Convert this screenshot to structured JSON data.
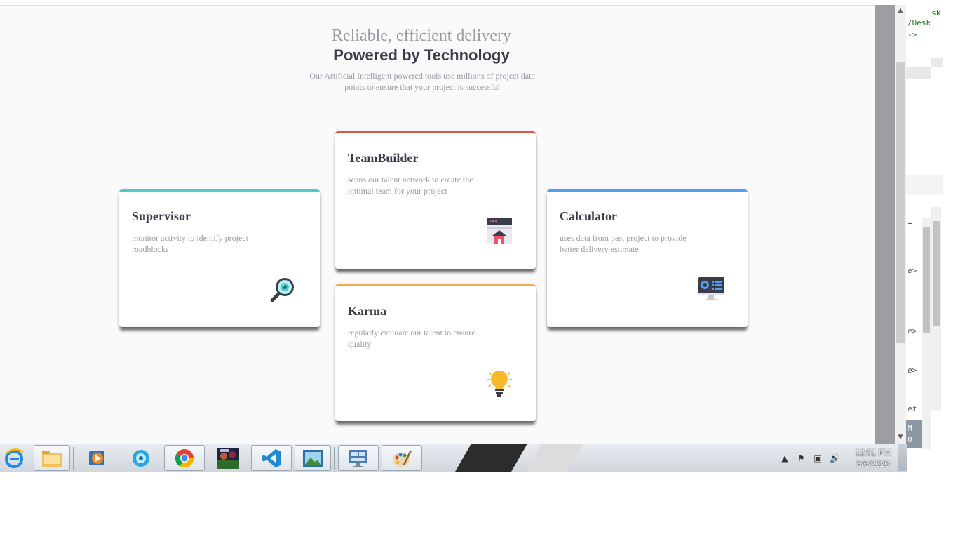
{
  "header": {
    "subtitle": "Reliable, efficient delivery",
    "title": "Powered by Technology",
    "description": "Our Artificial Intelligent powered tools use millions of project data points to ensure that your project is successful"
  },
  "cards": {
    "supervisor": {
      "title": "Supervisor",
      "text": "monitor activity to identify project roadblocks",
      "icon": "magnifier-icon",
      "accent": "#4dcbcb"
    },
    "teambuilder": {
      "title": "TeamBuilder",
      "text": "scans our talent network to create the optimal team for your project",
      "icon": "browser-home-icon",
      "accent": "#d85b4a"
    },
    "karma": {
      "title": "Karma",
      "text": "regularly evaluate our talent to ensure quality",
      "icon": "lightbulb-icon",
      "accent": "#f2a951"
    },
    "calculator": {
      "title": "Calculator",
      "text": "uses data from past project to provide better delivery estimate",
      "icon": "monitor-dashboard-icon",
      "accent": "#549ef2"
    }
  },
  "editor_panel": {
    "line1": "sk",
    "line2": "/Desk",
    "line3": "->",
    "frag1": "e>",
    "frag2": "e>",
    "frag3": "e>",
    "frag4": "et",
    "frag5": "M",
    "frag6": "0"
  },
  "taskbar": {
    "apps": [
      "internet-explorer-icon",
      "file-explorer-icon",
      "media-player-icon",
      "orb-app-icon",
      "chrome-icon",
      "game-pes-icon",
      "vscode-icon",
      "photo-viewer-icon",
      "remote-desktop-icon",
      "paint-icon"
    ],
    "clock_time": "12:51 PM",
    "clock_date": "5/6/2020"
  }
}
